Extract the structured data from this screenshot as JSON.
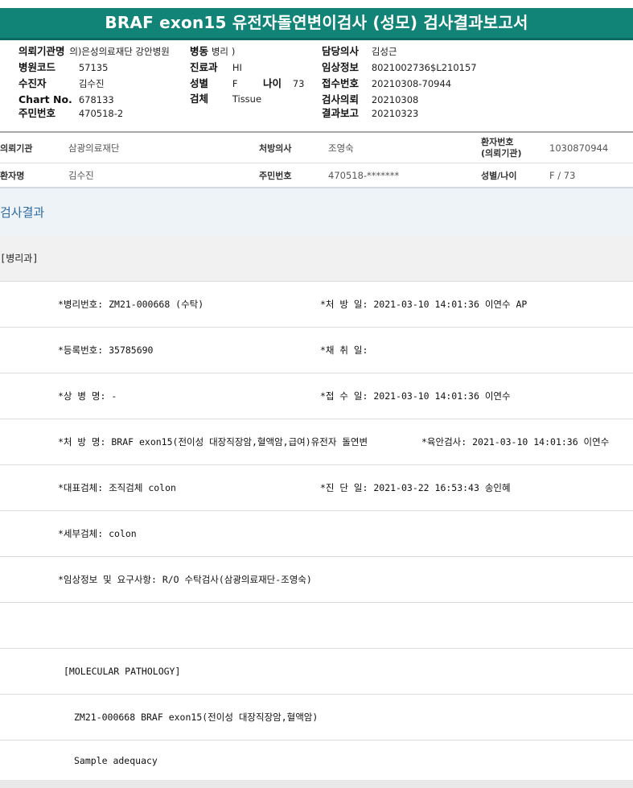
{
  "title": "BRAF exon15 유전자돌연변이검사 (성모) 검사결과보고서",
  "header": {
    "left": [
      {
        "label": "의뢰기관명",
        "value": "의)은성의료재단 강안병원"
      },
      {
        "label": "병원코드",
        "value": "57135"
      },
      {
        "label": "수진자",
        "value": "김수진"
      },
      {
        "label": "Chart No.",
        "value": "678133"
      },
      {
        "label": "주민번호",
        "value": "470518-2"
      }
    ],
    "middle": [
      {
        "label": "병동",
        "value": "병리"
      },
      {
        "label": "진료과",
        "value": "HI"
      },
      {
        "label": "성별",
        "value": "F"
      },
      {
        "label": "검체",
        "value": "Tissue"
      }
    ],
    "age": {
      "label": "나이",
      "value": "73"
    },
    "right": [
      {
        "label": "담당의사",
        "value": "김성근"
      },
      {
        "label": "임상정보",
        "value": "8021002736$L210157"
      },
      {
        "label": "접수번호",
        "value": "20210308-70944"
      },
      {
        "label": "검사의뢰",
        "value": "20210308"
      },
      {
        "label": "결과보고",
        "value": "20210323"
      }
    ]
  },
  "info": {
    "row1": {
      "institution_label": "의뢰기관",
      "institution": "삼광의료재단",
      "doctor_label": "처방의사",
      "doctor": "조영숙",
      "patient_no_label": [
        "환자번호",
        "(의뢰기관)"
      ],
      "patient_no": "1030870944"
    },
    "row2": {
      "name_label": "환자명",
      "name": "김수진",
      "id_label": "주민번호",
      "id": "470518-*******",
      "sexage_label": "성별/나이",
      "sexage": "F / 73"
    }
  },
  "section_title": "검사결과",
  "subsection": "[병리과]",
  "results": [
    {
      "left": "*병리번호: ZM21-000668 (수탁)",
      "right": "*처 방 일: 2021-03-10 14:01:36  이연수 AP"
    },
    {
      "left": "*등록번호: 35785690",
      "right": "*채 취 일:"
    },
    {
      "left": "*상 병 명: -",
      "right": "*접 수 일: 2021-03-10 14:01:36  이연수"
    },
    {
      "left": "*처 방 명: BRAF exon15(전이성 대장직장암,혈액암,급여)유전자 돌연변",
      "right": "*육안검사: 2021-03-10 14:01:36  이연수"
    },
    {
      "left": "*대표검체: 조직검체 colon",
      "right": "*진 단 일: 2021-03-22 16:53:43  송인혜"
    },
    {
      "left": "*세부검체: colon",
      "right": ""
    },
    {
      "left": "*임상정보 및 요구사항: R/O 수탁검사(삼광의료재단-조영숙)",
      "right": ""
    },
    {
      "left": "",
      "right": ""
    },
    {
      "left": "[MOLECULAR PATHOLOGY]",
      "right": ""
    },
    {
      "left": "ZM21-000668     BRAF exon15(전이성 대장직장암,혈액암)",
      "right": ""
    },
    {
      "left": "Sample adequacy",
      "right": ""
    }
  ],
  "colors": {
    "title_bg": "#118377",
    "section_text": "#2c6aa0"
  }
}
